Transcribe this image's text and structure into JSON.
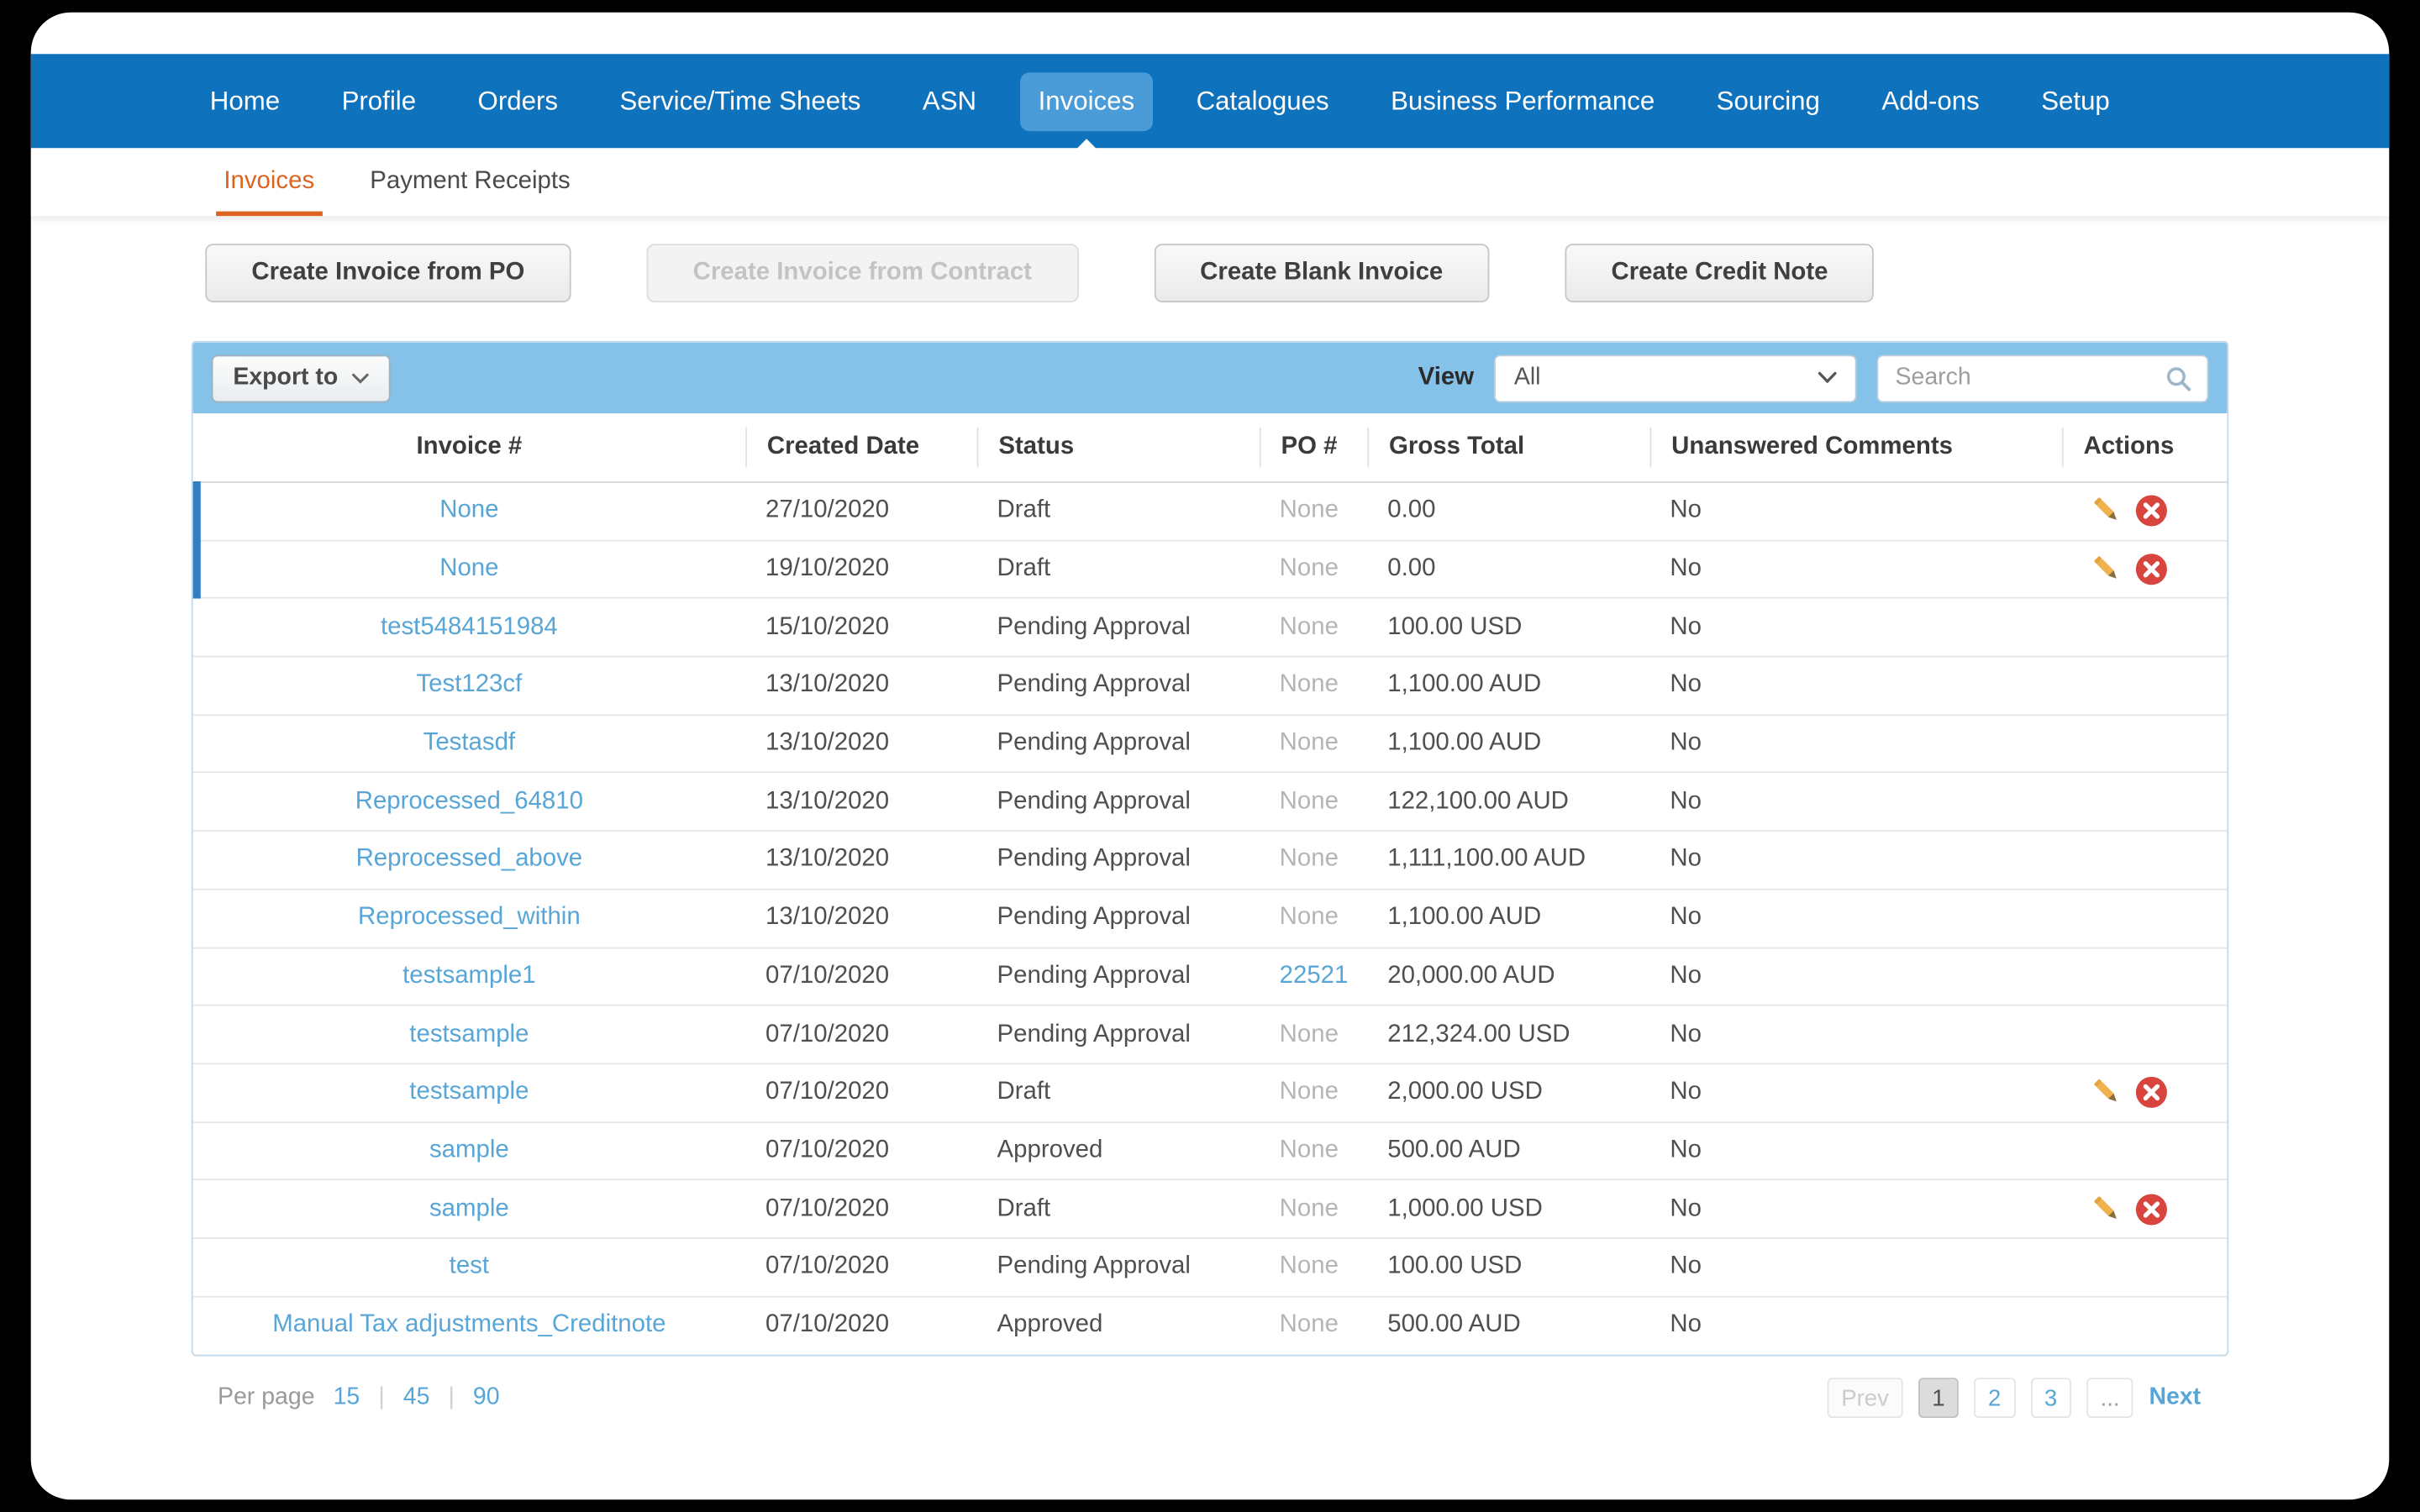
{
  "nav": {
    "items": [
      {
        "label": "Home",
        "active": false
      },
      {
        "label": "Profile",
        "active": false
      },
      {
        "label": "Orders",
        "active": false
      },
      {
        "label": "Service/Time Sheets",
        "active": false
      },
      {
        "label": "ASN",
        "active": false
      },
      {
        "label": "Invoices",
        "active": true
      },
      {
        "label": "Catalogues",
        "active": false
      },
      {
        "label": "Business Performance",
        "active": false
      },
      {
        "label": "Sourcing",
        "active": false
      },
      {
        "label": "Add-ons",
        "active": false
      },
      {
        "label": "Setup",
        "active": false
      }
    ]
  },
  "subnav": {
    "items": [
      {
        "label": "Invoices",
        "active": true
      },
      {
        "label": "Payment Receipts",
        "active": false
      }
    ]
  },
  "actions_bar": {
    "buttons": [
      {
        "label": "Create Invoice from PO",
        "enabled": true
      },
      {
        "label": "Create Invoice from Contract",
        "enabled": false
      },
      {
        "label": "Create Blank Invoice",
        "enabled": true
      },
      {
        "label": "Create Credit Note",
        "enabled": true
      }
    ]
  },
  "table_toolbar": {
    "export_label": "Export to",
    "view_label": "View",
    "view_value": "All",
    "search_placeholder": "Search"
  },
  "table": {
    "columns": [
      "Invoice #",
      "Created Date",
      "Status",
      "PO #",
      "Gross Total",
      "Unanswered Comments",
      "Actions"
    ],
    "rows": [
      {
        "invoice": "None",
        "created": "27/10/2020",
        "status": "Draft",
        "po": "None",
        "po_is_link": false,
        "gross": "0.00",
        "comments": "No",
        "has_actions": true,
        "highlight": true
      },
      {
        "invoice": "None",
        "created": "19/10/2020",
        "status": "Draft",
        "po": "None",
        "po_is_link": false,
        "gross": "0.00",
        "comments": "No",
        "has_actions": true,
        "highlight": true
      },
      {
        "invoice": "test5484151984",
        "created": "15/10/2020",
        "status": "Pending Approval",
        "po": "None",
        "po_is_link": false,
        "gross": "100.00 USD",
        "comments": "No",
        "has_actions": false,
        "highlight": false
      },
      {
        "invoice": "Test123cf",
        "created": "13/10/2020",
        "status": "Pending Approval",
        "po": "None",
        "po_is_link": false,
        "gross": "1,100.00 AUD",
        "comments": "No",
        "has_actions": false,
        "highlight": false
      },
      {
        "invoice": "Testasdf",
        "created": "13/10/2020",
        "status": "Pending Approval",
        "po": "None",
        "po_is_link": false,
        "gross": "1,100.00 AUD",
        "comments": "No",
        "has_actions": false,
        "highlight": false
      },
      {
        "invoice": "Reprocessed_64810",
        "created": "13/10/2020",
        "status": "Pending Approval",
        "po": "None",
        "po_is_link": false,
        "gross": "122,100.00 AUD",
        "comments": "No",
        "has_actions": false,
        "highlight": false
      },
      {
        "invoice": "Reprocessed_above",
        "created": "13/10/2020",
        "status": "Pending Approval",
        "po": "None",
        "po_is_link": false,
        "gross": "1,111,100.00 AUD",
        "comments": "No",
        "has_actions": false,
        "highlight": false
      },
      {
        "invoice": "Reprocessed_within",
        "created": "13/10/2020",
        "status": "Pending Approval",
        "po": "None",
        "po_is_link": false,
        "gross": "1,100.00 AUD",
        "comments": "No",
        "has_actions": false,
        "highlight": false
      },
      {
        "invoice": "testsample1",
        "created": "07/10/2020",
        "status": "Pending Approval",
        "po": "22521",
        "po_is_link": true,
        "gross": "20,000.00 AUD",
        "comments": "No",
        "has_actions": false,
        "highlight": false
      },
      {
        "invoice": "testsample",
        "created": "07/10/2020",
        "status": "Pending Approval",
        "po": "None",
        "po_is_link": false,
        "gross": "212,324.00 USD",
        "comments": "No",
        "has_actions": false,
        "highlight": false
      },
      {
        "invoice": "testsample",
        "created": "07/10/2020",
        "status": "Draft",
        "po": "None",
        "po_is_link": false,
        "gross": "2,000.00 USD",
        "comments": "No",
        "has_actions": true,
        "highlight": false
      },
      {
        "invoice": "sample",
        "created": "07/10/2020",
        "status": "Approved",
        "po": "None",
        "po_is_link": false,
        "gross": "500.00 AUD",
        "comments": "No",
        "has_actions": false,
        "highlight": false
      },
      {
        "invoice": "sample",
        "created": "07/10/2020",
        "status": "Draft",
        "po": "None",
        "po_is_link": false,
        "gross": "1,000.00 USD",
        "comments": "No",
        "has_actions": true,
        "highlight": false
      },
      {
        "invoice": "test",
        "created": "07/10/2020",
        "status": "Pending Approval",
        "po": "None",
        "po_is_link": false,
        "gross": "100.00 USD",
        "comments": "No",
        "has_actions": false,
        "highlight": false
      },
      {
        "invoice": "Manual Tax adjustments_Creditnote",
        "created": "07/10/2020",
        "status": "Approved",
        "po": "None",
        "po_is_link": false,
        "gross": "500.00 AUD",
        "comments": "No",
        "has_actions": false,
        "highlight": false
      }
    ]
  },
  "footer": {
    "per_page_label": "Per page",
    "separator": "|",
    "per_page_options": [
      "15",
      "45",
      "90"
    ],
    "pagination": {
      "prev": "Prev",
      "pages": [
        "1",
        "2",
        "3"
      ],
      "current_page": "1",
      "ellipsis": "...",
      "next": "Next"
    }
  },
  "colors": {
    "nav_blue": "#0f72bd",
    "nav_active_blue": "#4a9cd9",
    "toolbar_blue": "#85c2e9",
    "accent_orange": "#dd6420",
    "link_blue": "#58a6d7",
    "delete_red": "#d8453e",
    "pencil_yellow": "#f0b24e"
  }
}
